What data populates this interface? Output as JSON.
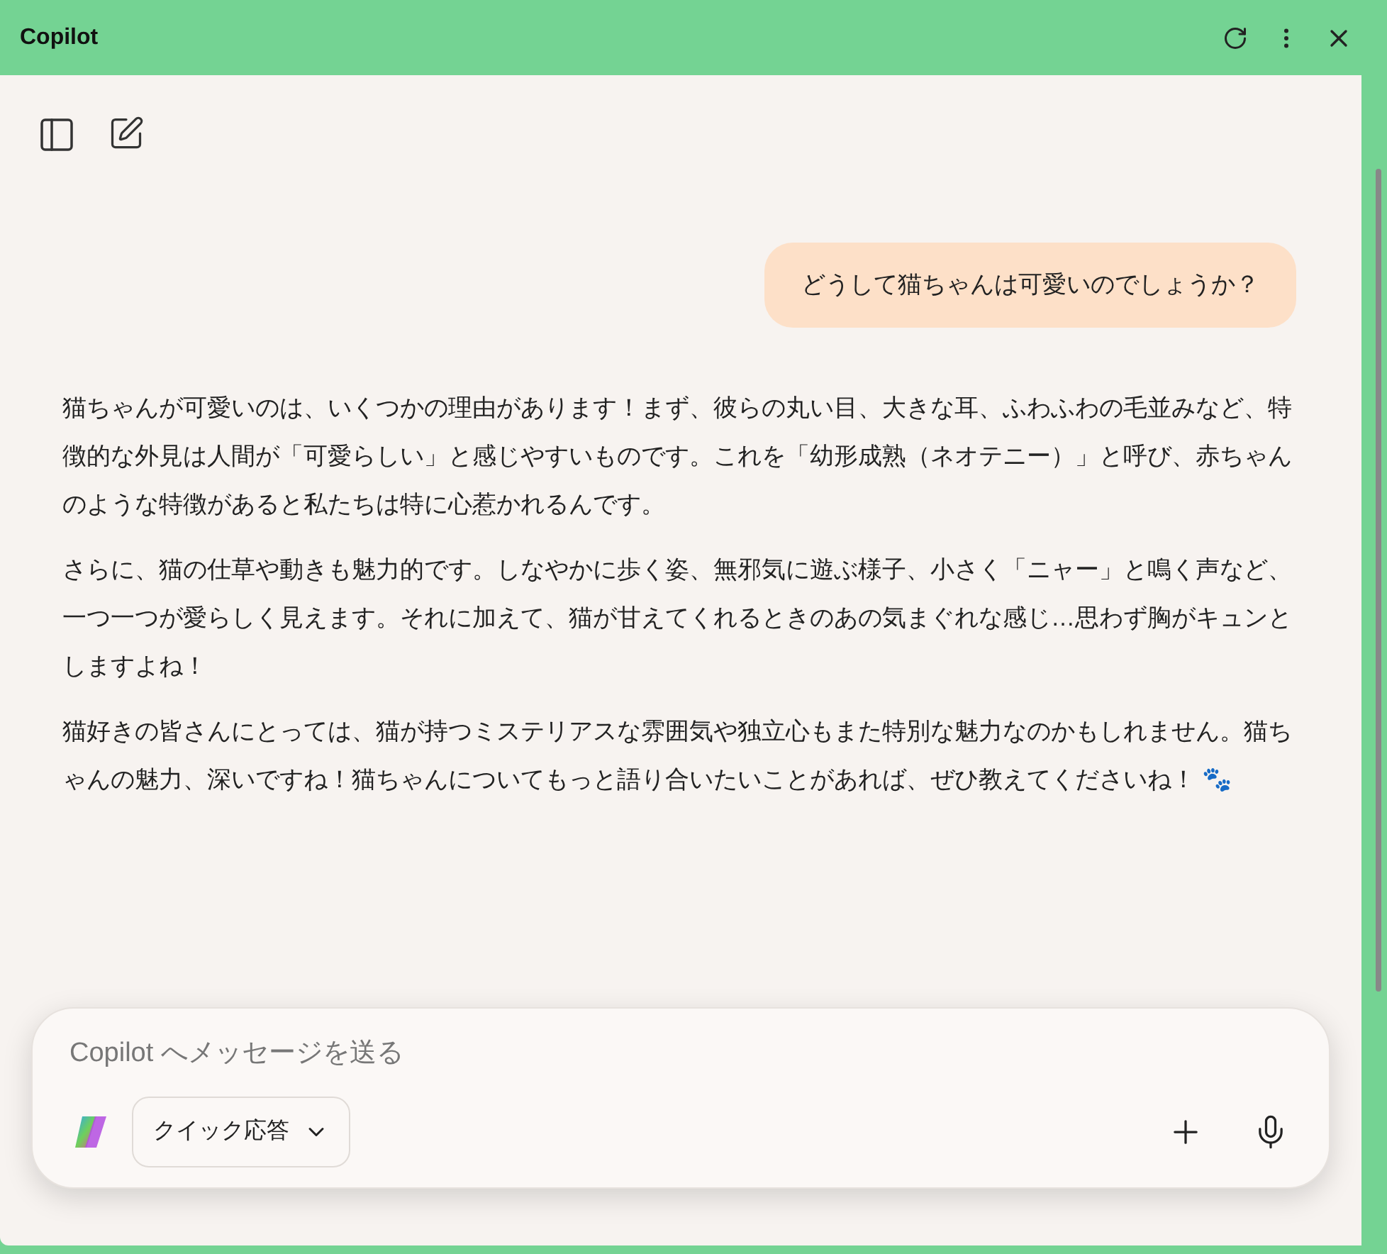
{
  "window": {
    "title": "Copilot"
  },
  "user_message": "どうして猫ちゃんは可愛いのでしょうか？",
  "reply_paragraphs": [
    "猫ちゃんが可愛いのは、いくつかの理由があります！まず、彼らの丸い目、大きな耳、ふわふわの毛並みなど、特徴的な外見は人間が「可愛らしい」と感じやすいものです。これを「幼形成熟（ネオテニー）」と呼び、赤ちゃんのような特徴があると私たちは特に心惹かれるんです。",
    "さらに、猫の仕草や動きも魅力的です。しなやかに歩く姿、無邪気に遊ぶ様子、小さく「ニャー」と鳴く声など、一つ一つが愛らしく見えます。それに加えて、猫が甘えてくれるときのあの気まぐれな感じ…思わず胸がキュンとしますよね！",
    "猫好きの皆さんにとっては、猫が持つミステリアスな雰囲気や独立心もまた特別な魅力なのかもしれません。猫ちゃんの魅力、深いですね！猫ちゃんについてもっと語り合いたいことがあれば、ぜひ教えてくださいね！ 🐾"
  ],
  "composer": {
    "placeholder": "Copilot へメッセージを送る",
    "mode": "クイック応答"
  }
}
